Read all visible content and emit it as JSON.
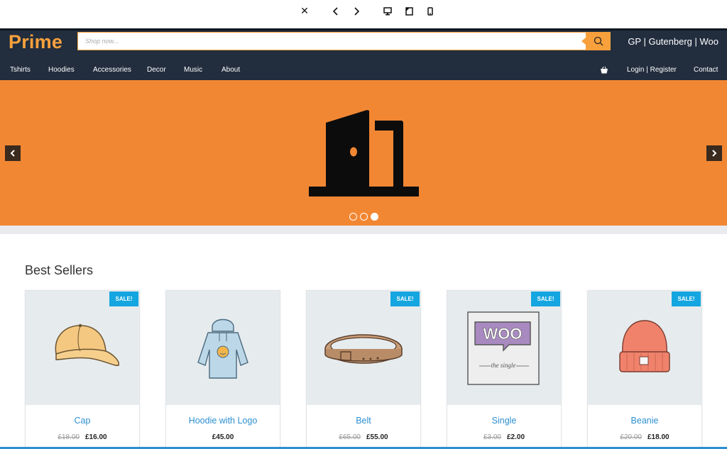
{
  "header": {
    "logo": "Prime",
    "search_placeholder": "Shop now...",
    "tagline": "GP | Gutenberg | Woo"
  },
  "nav": {
    "items": [
      "Tshirts",
      "Hoodies",
      "Accessories",
      "Decor",
      "Music",
      "About"
    ],
    "login": "Login | Register",
    "contact": "Contact"
  },
  "hero": {
    "slides": 3,
    "active_slide": 3
  },
  "best_sellers": {
    "title": "Best Sellers",
    "sale_label": "SALE!",
    "products": [
      {
        "name": "Cap",
        "old_price": "£18.00",
        "price": "£16.00",
        "sale": true
      },
      {
        "name": "Hoodie with Logo",
        "old_price": "",
        "price": "£45.00",
        "sale": false
      },
      {
        "name": "Belt",
        "old_price": "£65.00",
        "price": "£55.00",
        "sale": true
      },
      {
        "name": "Single",
        "old_price": "£3.00",
        "price": "£2.00",
        "sale": true
      },
      {
        "name": "Beanie",
        "old_price": "£20.00",
        "price": "£18.00",
        "sale": true
      }
    ]
  },
  "colors": {
    "header_bg": "#222d3e",
    "accent_orange": "#f8a13c",
    "hero_bg": "#f28733",
    "sale_badge": "#14a6e0",
    "link_blue": "#2d8fd0"
  }
}
